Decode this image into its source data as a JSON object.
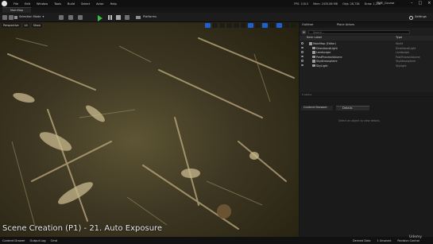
{
  "menu": [
    "File",
    "Edit",
    "Window",
    "Tools",
    "Build",
    "Select",
    "Actor",
    "Help"
  ],
  "stats": [
    "FPS: 118.5",
    "Mem: 2435.86 MB",
    "Objs: 28,738",
    "Draw: 1,206"
  ],
  "project_name": "TWE_Course",
  "level_tab": "MainMap",
  "toolbar": {
    "selection_mode": "Selection Mode",
    "platforms": "Platforms",
    "settings": "Settings"
  },
  "viewport": {
    "buttons": [
      "Perspective",
      "Lit",
      "Show"
    ],
    "caption": "Scene Creation (P1) - 21. Auto Exposure"
  },
  "outliner": {
    "tab": "Outliner",
    "place_actors_tab": "Place Actors",
    "search_placeholder": "Search...",
    "col_label": "Item Label",
    "col_type": "Type",
    "rows": [
      {
        "label": "MainMap (Editor)",
        "type": "World"
      },
      {
        "label": "DirectionalLight",
        "type": "DirectionalLight"
      },
      {
        "label": "Landscape",
        "type": "Landscape"
      },
      {
        "label": "PostProcessVolume",
        "type": "PostProcessVolume"
      },
      {
        "label": "SkyAtmosphere",
        "type": "SkyAtmosphere"
      },
      {
        "label": "SkyLight",
        "type": "SkyLight"
      }
    ],
    "footer": "5 actors"
  },
  "details": {
    "content_browser_tab": "Content Browser",
    "details_tab": "Details",
    "empty_message": "Select an object to view details."
  },
  "status": {
    "left": [
      "Content Drawer",
      "Output Log",
      "Cmd"
    ],
    "right": [
      "Derived Data",
      "1 Unsaved",
      "Revision Control"
    ],
    "watermark": "Udemy"
  },
  "colors": {
    "accent": "#1c60d6",
    "play": "#39c13b"
  }
}
